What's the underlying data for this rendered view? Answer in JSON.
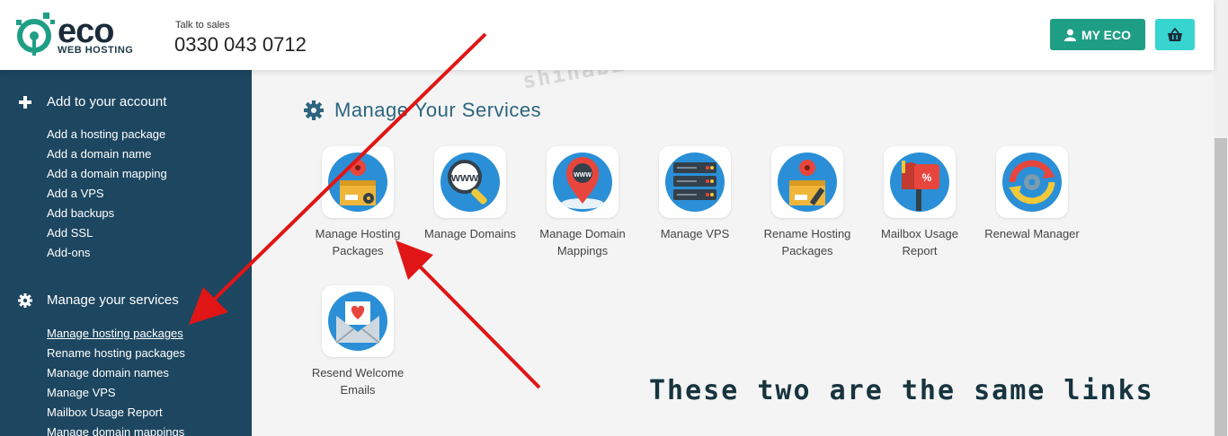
{
  "header": {
    "logo_word": "eco",
    "logo_sub": "WEB HOSTING",
    "sales_label": "Talk to sales",
    "sales_phone": "0330 043 0712",
    "myeco_label": "MY ECO"
  },
  "sidebar": {
    "section1_title": "Add to your account",
    "section1_items": [
      "Add a hosting package",
      "Add a domain name",
      "Add a domain mapping",
      "Add a VPS",
      "Add backups",
      "Add SSL",
      "Add-ons"
    ],
    "section2_title": "Manage your services",
    "section2_items": [
      "Manage hosting packages",
      "Rename hosting packages",
      "Manage domain names",
      "Manage VPS",
      "Mailbox Usage Report",
      "Manage domain mappings"
    ]
  },
  "main": {
    "title": "Manage Your Services",
    "tiles": [
      {
        "label": "Manage Hosting Packages",
        "icon": "hosting-box-icon"
      },
      {
        "label": "Manage Domains",
        "icon": "www-magnifier-icon"
      },
      {
        "label": "Manage Domain Mappings",
        "icon": "www-map-pin-icon"
      },
      {
        "label": "Manage VPS",
        "icon": "server-rack-icon"
      },
      {
        "label": "Rename Hosting Packages",
        "icon": "hosting-box-pencil-icon"
      },
      {
        "label": "Mailbox Usage Report",
        "icon": "mailbox-icon"
      },
      {
        "label": "Renewal Manager",
        "icon": "renewal-cycle-icon"
      },
      {
        "label": "Resend Welcome Emails",
        "icon": "envelope-heart-icon"
      }
    ]
  },
  "annotation": {
    "watermark": "shihabiuc.com",
    "callout": "These two are the same links"
  },
  "colors": {
    "sidebar_bg": "#1d4660",
    "brand_green": "#1f9e86",
    "cart_cyan": "#37d5d0",
    "title_blue": "#2c6580",
    "arrow_red": "#e01515"
  }
}
